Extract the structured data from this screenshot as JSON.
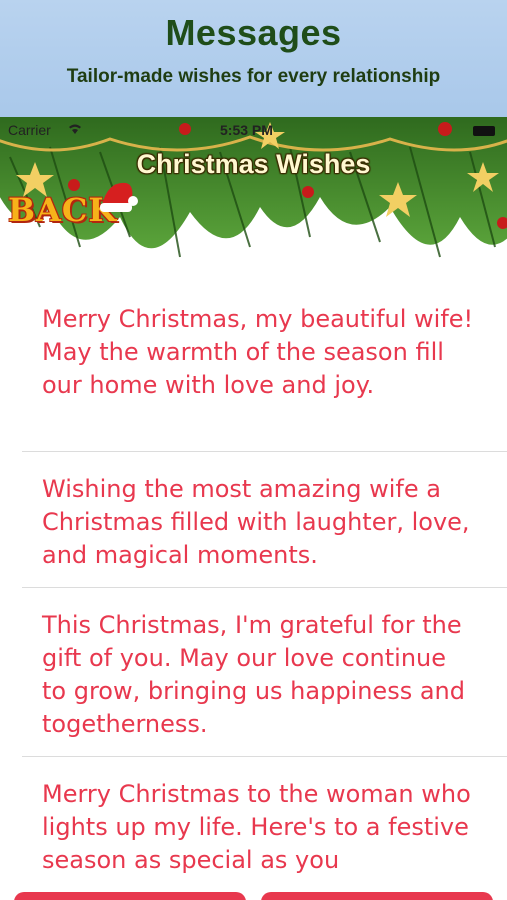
{
  "promo": {
    "title": "Messages",
    "subtitle": "Tailor-made wishes for every relationship"
  },
  "status_bar": {
    "carrier": "Carrier",
    "time": "5:53 PM"
  },
  "nav": {
    "title": "Christmas Wishes",
    "back_label": "BACK"
  },
  "messages": [
    "Merry Christmas, my beautiful wife! May the warmth of the season fill our home with love and joy.",
    "Wishing the most amazing wife a Christmas filled with laughter, love, and magical moments.",
    "This Christmas, I'm grateful for the gift of you. May our love continue to grow, bringing us happiness and togetherness.",
    "Merry Christmas to the woman who lights up my life. Here's to a festive season as special as you"
  ],
  "colors": {
    "accent": "#e8384e",
    "promo_bg": "#b1cdec",
    "promo_title": "#1f4d19"
  },
  "icons": {
    "wifi": "wifi-icon",
    "battery": "battery-icon",
    "santa_hat": "santa-hat-icon"
  }
}
